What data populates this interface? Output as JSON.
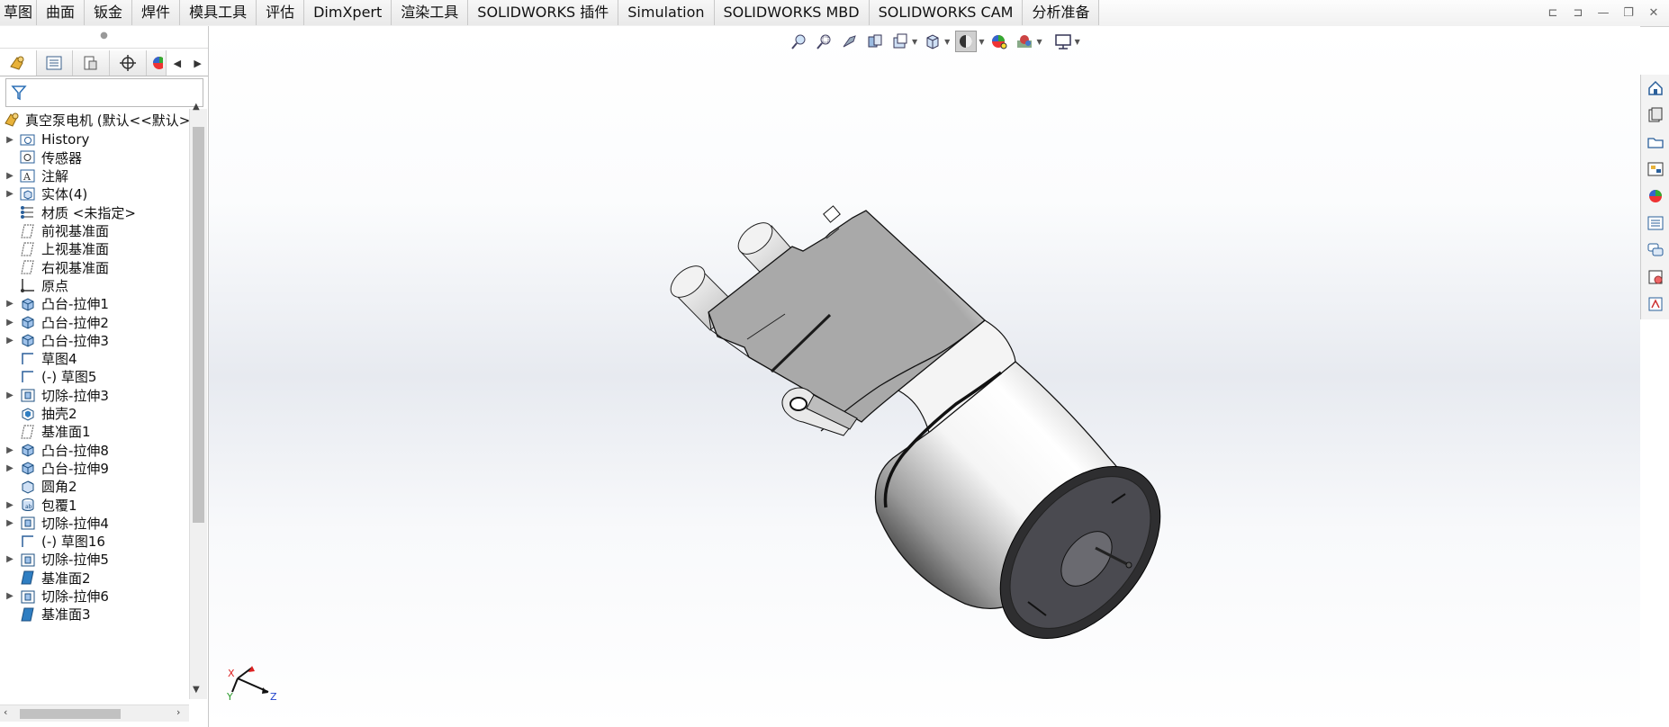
{
  "command_tabs": [
    "草图",
    "曲面",
    "钣金",
    "焊件",
    "模具工具",
    "评估",
    "DimXpert",
    "渲染工具",
    "SOLIDWORKS 插件",
    "Simulation",
    "SOLIDWORKS MBD",
    "SOLIDWORKS CAM",
    "分析准备"
  ],
  "window_controls": [
    "restore-left-icon",
    "restore-right-icon",
    "minimize-icon",
    "maximize-icon",
    "close-icon"
  ],
  "feature_manager": {
    "root_label": "真空泵电机  (默认<<默认>",
    "items": [
      {
        "label": "History",
        "expandable": true,
        "icon": "history-folder-icon"
      },
      {
        "label": "传感器",
        "expandable": false,
        "icon": "sensor-icon"
      },
      {
        "label": "注解",
        "expandable": true,
        "icon": "annotation-icon"
      },
      {
        "label": "实体(4)",
        "expandable": true,
        "icon": "solid-bodies-icon"
      },
      {
        "label": "材质 <未指定>",
        "expandable": false,
        "icon": "material-icon"
      },
      {
        "label": "前视基准面",
        "expandable": false,
        "icon": "plane-icon"
      },
      {
        "label": "上视基准面",
        "expandable": false,
        "icon": "plane-icon"
      },
      {
        "label": "右视基准面",
        "expandable": false,
        "icon": "plane-icon"
      },
      {
        "label": "原点",
        "expandable": false,
        "icon": "origin-icon"
      },
      {
        "label": "凸台-拉伸1",
        "expandable": true,
        "icon": "boss-extrude-icon"
      },
      {
        "label": "凸台-拉伸2",
        "expandable": true,
        "icon": "boss-extrude-icon"
      },
      {
        "label": "凸台-拉伸3",
        "expandable": true,
        "icon": "boss-extrude-icon"
      },
      {
        "label": "草图4",
        "expandable": false,
        "icon": "sketch-icon"
      },
      {
        "label": "(-) 草图5",
        "expandable": false,
        "icon": "sketch-icon"
      },
      {
        "label": "切除-拉伸3",
        "expandable": true,
        "icon": "cut-extrude-icon"
      },
      {
        "label": "抽壳2",
        "expandable": false,
        "icon": "shell-icon"
      },
      {
        "label": "基准面1",
        "expandable": false,
        "icon": "plane-icon"
      },
      {
        "label": "凸台-拉伸8",
        "expandable": true,
        "icon": "boss-extrude-icon"
      },
      {
        "label": "凸台-拉伸9",
        "expandable": true,
        "icon": "boss-extrude-icon"
      },
      {
        "label": "圆角2",
        "expandable": false,
        "icon": "fillet-icon"
      },
      {
        "label": "包覆1",
        "expandable": true,
        "icon": "wrap-icon"
      },
      {
        "label": "切除-拉伸4",
        "expandable": true,
        "icon": "cut-extrude-icon"
      },
      {
        "label": "(-) 草图16",
        "expandable": false,
        "icon": "sketch-icon"
      },
      {
        "label": "切除-拉伸5",
        "expandable": true,
        "icon": "cut-extrude-icon"
      },
      {
        "label": "基准面2",
        "expandable": false,
        "icon": "plane-solid-icon"
      },
      {
        "label": "切除-拉伸6",
        "expandable": true,
        "icon": "cut-extrude-icon"
      },
      {
        "label": "基准面3",
        "expandable": false,
        "icon": "plane-solid-icon"
      }
    ]
  },
  "triad": {
    "x": "X",
    "y": "Y",
    "z": "Z"
  },
  "colors": {
    "accent": "#1f6fc5",
    "model_body": "#dcdcdc",
    "model_dark": "#3a3a3a"
  }
}
